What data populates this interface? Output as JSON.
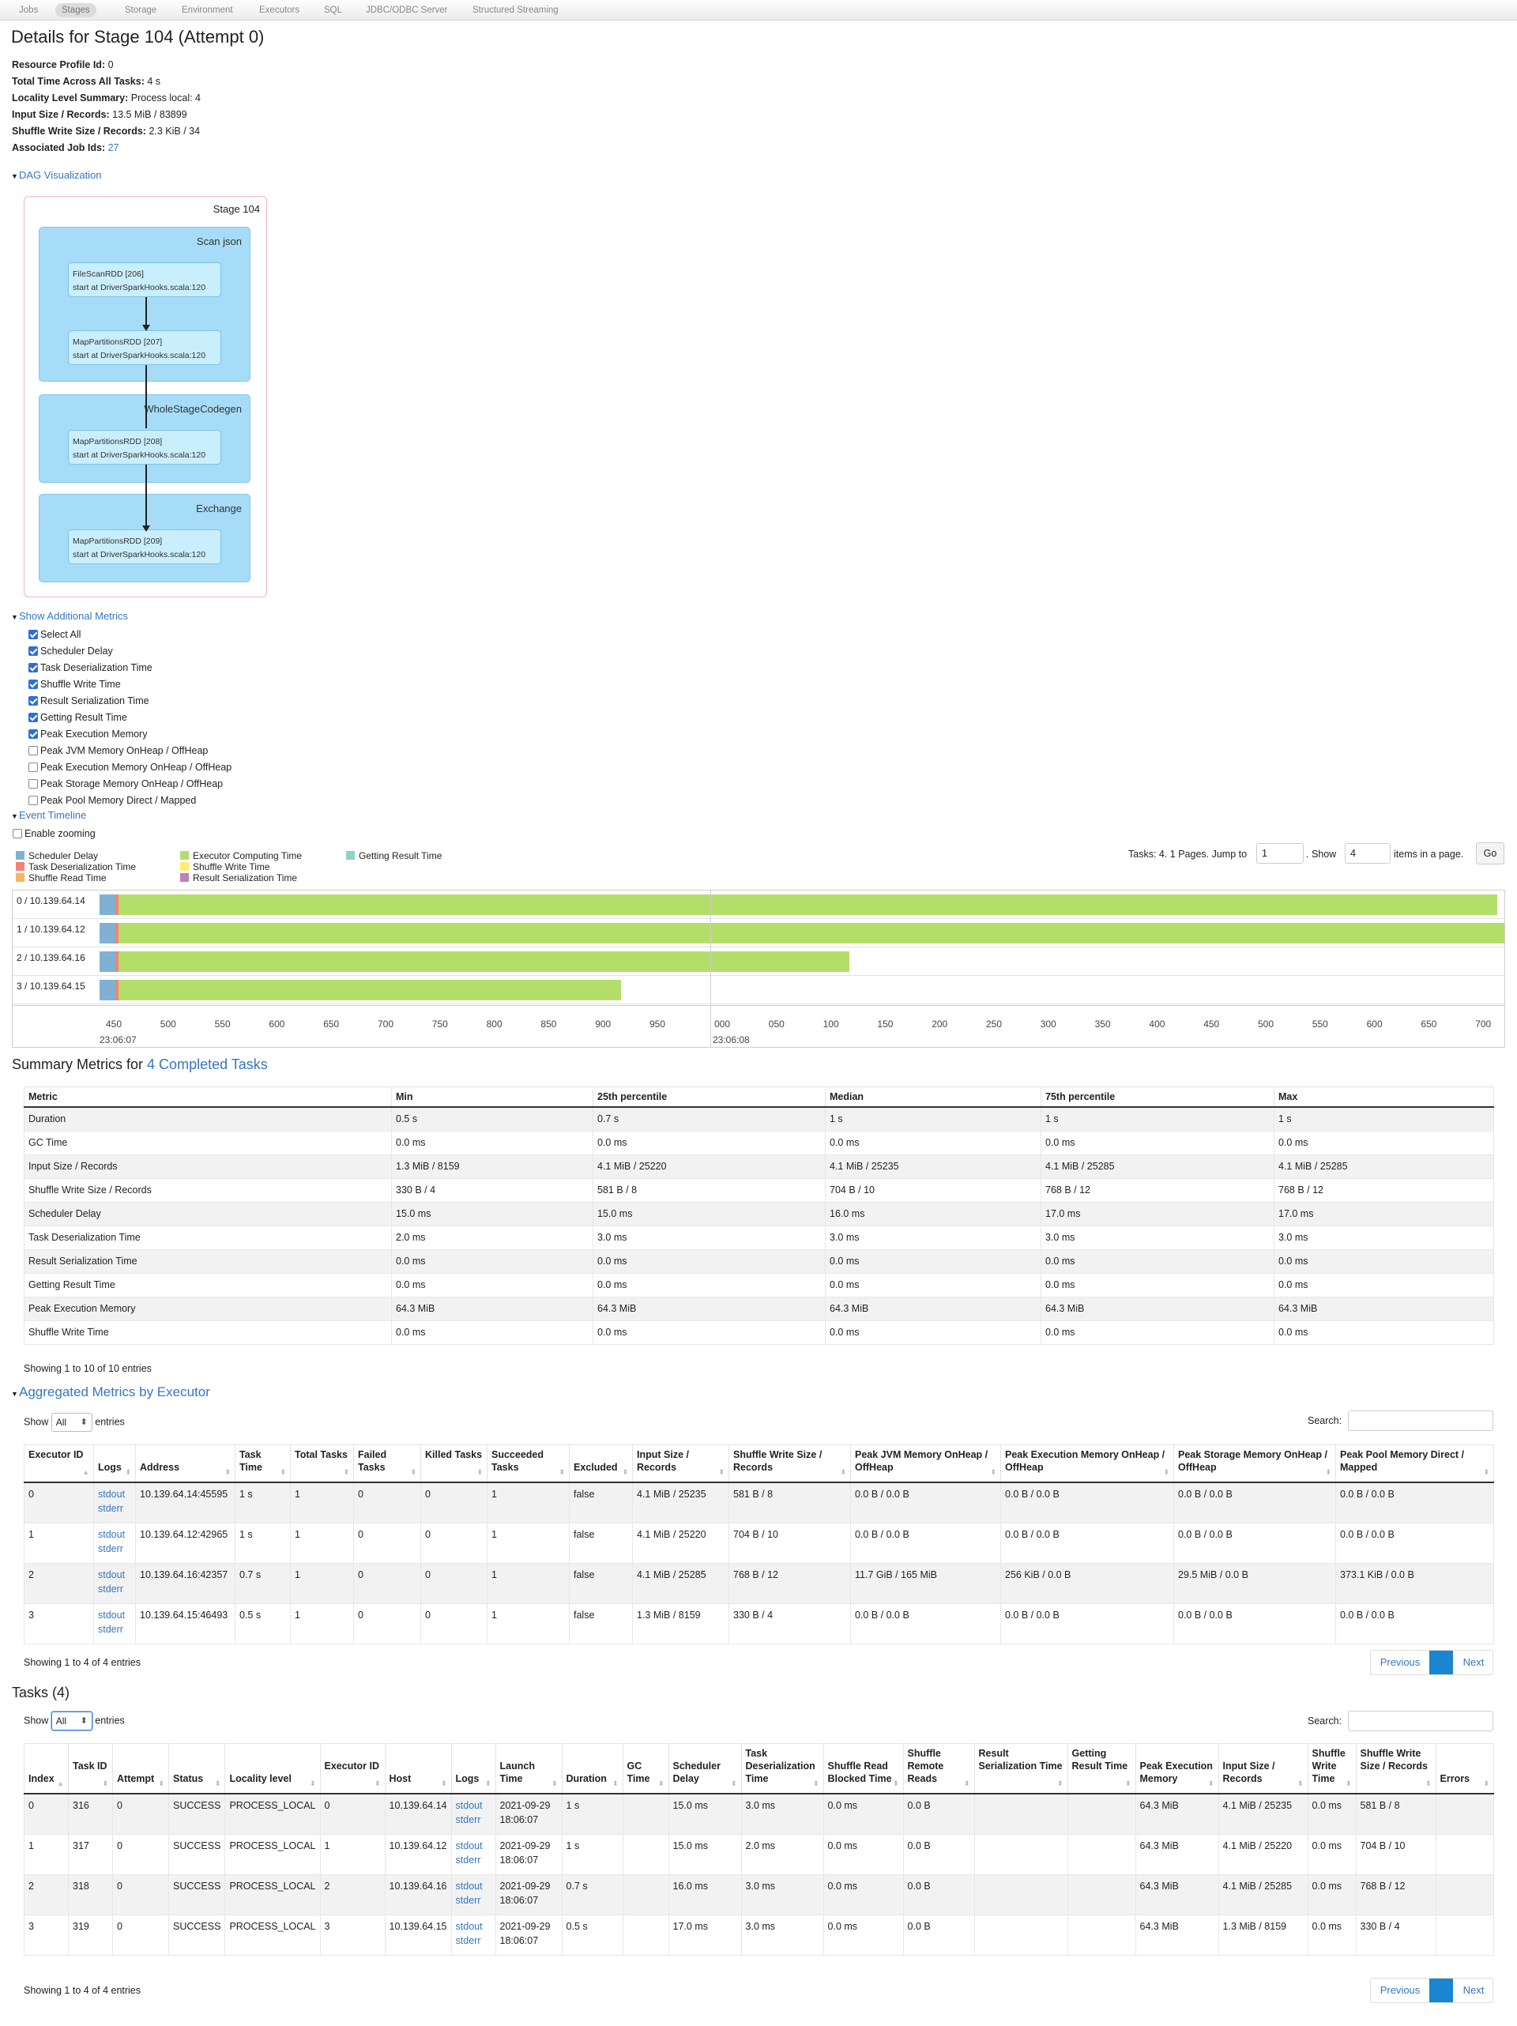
{
  "nav": {
    "tabs": [
      "Jobs",
      "Stages",
      "Storage",
      "Environment",
      "Executors",
      "SQL",
      "JDBC/ODBC Server",
      "Structured Streaming"
    ],
    "active": "Stages"
  },
  "title": "Details for Stage 104 (Attempt 0)",
  "summary": [
    {
      "k": "Resource Profile Id:",
      "v": "0"
    },
    {
      "k": "Total Time Across All Tasks:",
      "v": "4 s"
    },
    {
      "k": "Locality Level Summary:",
      "v": "Process local: 4"
    },
    {
      "k": "Input Size / Records:",
      "v": "13.5 MiB / 83899"
    },
    {
      "k": "Shuffle Write Size / Records:",
      "v": "2.3 KiB / 34"
    },
    {
      "k": "Associated Job Ids:",
      "v": "27"
    }
  ],
  "dag": {
    "toggle": "DAG Visualization",
    "stage": "Stage 104",
    "clusters": [
      "Scan json",
      "WholeStageCodegen",
      "Exchange"
    ],
    "rdds": [
      {
        "name": "FileScanRDD [206]",
        "site": "start at DriverSparkHooks.scala:120"
      },
      {
        "name": "MapPartitionsRDD [207]",
        "site": "start at DriverSparkHooks.scala:120"
      },
      {
        "name": "MapPartitionsRDD [208]",
        "site": "start at DriverSparkHooks.scala:120"
      },
      {
        "name": "MapPartitionsRDD [209]",
        "site": "start at DriverSparkHooks.scala:120"
      }
    ]
  },
  "metrics": {
    "toggle": "Show Additional Metrics",
    "items": [
      {
        "label": "Select All",
        "checked": true
      },
      {
        "label": "Scheduler Delay",
        "checked": true
      },
      {
        "label": "Task Deserialization Time",
        "checked": true
      },
      {
        "label": "Shuffle Write Time",
        "checked": true
      },
      {
        "label": "Result Serialization Time",
        "checked": true
      },
      {
        "label": "Getting Result Time",
        "checked": true
      },
      {
        "label": "Peak Execution Memory",
        "checked": true
      },
      {
        "label": "Peak JVM Memory OnHeap / OffHeap",
        "checked": false
      },
      {
        "label": "Peak Execution Memory OnHeap / OffHeap",
        "checked": false
      },
      {
        "label": "Peak Storage Memory OnHeap / OffHeap",
        "checked": false
      },
      {
        "label": "Peak Pool Memory Direct / Mapped",
        "checked": false
      }
    ]
  },
  "timeline": {
    "toggle": "Event Timeline",
    "zoom_label": "Enable zooming",
    "legend": [
      {
        "label": "Scheduler Delay",
        "color": "#80b1d3"
      },
      {
        "label": "Task Deserialization Time",
        "color": "#fb8072"
      },
      {
        "label": "Shuffle Read Time",
        "color": "#fdb462"
      },
      {
        "label": "Executor Computing Time",
        "color": "#b3de69"
      },
      {
        "label": "Shuffle Write Time",
        "color": "#ffed6f"
      },
      {
        "label": "Result Serialization Time",
        "color": "#bc80bd"
      },
      {
        "label": "Getting Result Time",
        "color": "#8dd3c7"
      }
    ],
    "pager": {
      "tasks_text": "Tasks: 4. 1 Pages. Jump to",
      "page": "1",
      "show_text": ". Show",
      "show": "4",
      "items_text": "items in a page.",
      "go": "Go"
    },
    "rows": [
      {
        "label": "0 / 10.139.64.14",
        "frac": 0.995
      },
      {
        "label": "1 / 10.139.64.12",
        "frac": 1.0
      },
      {
        "label": "2 / 10.139.64.16",
        "frac": 0.534
      },
      {
        "label": "3 / 10.139.64.15",
        "frac": 0.371
      }
    ],
    "ticks": [
      "450",
      "500",
      "550",
      "600",
      "650",
      "700",
      "750",
      "800",
      "850",
      "900",
      "950",
      "000",
      "050",
      "100",
      "150",
      "200",
      "250",
      "300",
      "350",
      "400",
      "450",
      "500",
      "550",
      "600",
      "650",
      "700"
    ],
    "time_labels": [
      "23:06:07",
      "23:06:08"
    ]
  },
  "summary_metrics": {
    "heading": "Summary Metrics for",
    "link": "4 Completed Tasks",
    "headers": [
      "Metric",
      "Min",
      "25th percentile",
      "Median",
      "75th percentile",
      "Max"
    ],
    "rows": [
      [
        "Duration",
        "0.5 s",
        "0.7 s",
        "1 s",
        "1 s",
        "1 s"
      ],
      [
        "GC Time",
        "0.0 ms",
        "0.0 ms",
        "0.0 ms",
        "0.0 ms",
        "0.0 ms"
      ],
      [
        "Input Size / Records",
        "1.3 MiB / 8159",
        "4.1 MiB / 25220",
        "4.1 MiB / 25235",
        "4.1 MiB / 25285",
        "4.1 MiB / 25285"
      ],
      [
        "Shuffle Write Size / Records",
        "330 B / 4",
        "581 B / 8",
        "704 B / 10",
        "768 B / 12",
        "768 B / 12"
      ],
      [
        "Scheduler Delay",
        "15.0 ms",
        "15.0 ms",
        "16.0 ms",
        "17.0 ms",
        "17.0 ms"
      ],
      [
        "Task Deserialization Time",
        "2.0 ms",
        "3.0 ms",
        "3.0 ms",
        "3.0 ms",
        "3.0 ms"
      ],
      [
        "Result Serialization Time",
        "0.0 ms",
        "0.0 ms",
        "0.0 ms",
        "0.0 ms",
        "0.0 ms"
      ],
      [
        "Getting Result Time",
        "0.0 ms",
        "0.0 ms",
        "0.0 ms",
        "0.0 ms",
        "0.0 ms"
      ],
      [
        "Peak Execution Memory",
        "64.3 MiB",
        "64.3 MiB",
        "64.3 MiB",
        "64.3 MiB",
        "64.3 MiB"
      ],
      [
        "Shuffle Write Time",
        "0.0 ms",
        "0.0 ms",
        "0.0 ms",
        "0.0 ms",
        "0.0 ms"
      ]
    ],
    "footer": "Showing 1 to 10 of 10 entries"
  },
  "executors": {
    "toggle": "Aggregated Metrics by Executor",
    "show_label": "Show",
    "show_value": "All",
    "entries_label": "entries",
    "search_label": "Search:",
    "headers": [
      "Executor ID",
      "Logs",
      "Address",
      "Task Time",
      "Total Tasks",
      "Failed Tasks",
      "Killed Tasks",
      "Succeeded Tasks",
      "Excluded",
      "Input Size / Records",
      "Shuffle Write Size / Records",
      "Peak JVM Memory OnHeap / OffHeap",
      "Peak Execution Memory OnHeap / OffHeap",
      "Peak Storage Memory OnHeap / OffHeap",
      "Peak Pool Memory Direct / Mapped"
    ],
    "rows": [
      [
        "0",
        "10.139.64.14:45595",
        "1 s",
        "1",
        "0",
        "0",
        "1",
        "false",
        "4.1 MiB / 25235",
        "581 B / 8",
        "0.0 B / 0.0 B",
        "0.0 B / 0.0 B",
        "0.0 B / 0.0 B",
        "0.0 B / 0.0 B"
      ],
      [
        "1",
        "10.139.64.12:42965",
        "1 s",
        "1",
        "0",
        "0",
        "1",
        "false",
        "4.1 MiB / 25220",
        "704 B / 10",
        "0.0 B / 0.0 B",
        "0.0 B / 0.0 B",
        "0.0 B / 0.0 B",
        "0.0 B / 0.0 B"
      ],
      [
        "2",
        "10.139.64.16:42357",
        "0.7 s",
        "1",
        "0",
        "0",
        "1",
        "false",
        "4.1 MiB / 25285",
        "768 B / 12",
        "11.7 GiB / 165 MiB",
        "256 KiB / 0.0 B",
        "29.5 MiB / 0.0 B",
        "373.1 KiB / 0.0 B"
      ],
      [
        "3",
        "10.139.64.15:46493",
        "0.5 s",
        "1",
        "0",
        "0",
        "1",
        "false",
        "1.3 MiB / 8159",
        "330 B / 4",
        "0.0 B / 0.0 B",
        "0.0 B / 0.0 B",
        "0.0 B / 0.0 B",
        "0.0 B / 0.0 B"
      ]
    ],
    "log_links": [
      "stdout",
      "stderr"
    ],
    "footer": "Showing 1 to 4 of 4 entries",
    "prev": "Previous",
    "next": "Next"
  },
  "tasks": {
    "heading": "Tasks (4)",
    "show_label": "Show",
    "show_value": "All",
    "entries_label": "entries",
    "search_label": "Search:",
    "headers": [
      "Index",
      "Task ID",
      "Attempt",
      "Status",
      "Locality level",
      "Executor ID",
      "Host",
      "Logs",
      "Launch Time",
      "Duration",
      "GC Time",
      "Scheduler Delay",
      "Task Deserialization Time",
      "Shuffle Read Blocked Time",
      "Shuffle Remote Reads",
      "Result Serialization Time",
      "Getting Result Time",
      "Peak Execution Memory",
      "Input Size / Records",
      "Shuffle Write Time",
      "Shuffle Write Size / Records",
      "Errors"
    ],
    "rows": [
      [
        "0",
        "316",
        "0",
        "SUCCESS",
        "PROCESS_LOCAL",
        "0",
        "10.139.64.14",
        "2021-09-29 18:06:07",
        "1 s",
        "",
        "15.0 ms",
        "3.0 ms",
        "0.0 ms",
        "0.0 B",
        "",
        "",
        "64.3 MiB",
        "4.1 MiB / 25235",
        "0.0 ms",
        "581 B / 8",
        ""
      ],
      [
        "1",
        "317",
        "0",
        "SUCCESS",
        "PROCESS_LOCAL",
        "1",
        "10.139.64.12",
        "2021-09-29 18:06:07",
        "1 s",
        "",
        "15.0 ms",
        "2.0 ms",
        "0.0 ms",
        "0.0 B",
        "",
        "",
        "64.3 MiB",
        "4.1 MiB / 25220",
        "0.0 ms",
        "704 B / 10",
        ""
      ],
      [
        "2",
        "318",
        "0",
        "SUCCESS",
        "PROCESS_LOCAL",
        "2",
        "10.139.64.16",
        "2021-09-29 18:06:07",
        "0.7 s",
        "",
        "16.0 ms",
        "3.0 ms",
        "0.0 ms",
        "0.0 B",
        "",
        "",
        "64.3 MiB",
        "4.1 MiB / 25285",
        "0.0 ms",
        "768 B / 12",
        ""
      ],
      [
        "3",
        "319",
        "0",
        "SUCCESS",
        "PROCESS_LOCAL",
        "3",
        "10.139.64.15",
        "2021-09-29 18:06:07",
        "0.5 s",
        "",
        "17.0 ms",
        "3.0 ms",
        "0.0 ms",
        "0.0 B",
        "",
        "",
        "64.3 MiB",
        "1.3 MiB / 8159",
        "0.0 ms",
        "330 B / 4",
        ""
      ]
    ],
    "log_links": [
      "stdout",
      "stderr"
    ],
    "footer": "Showing 1 to 4 of 4 entries",
    "prev": "Previous",
    "next": "Next"
  }
}
